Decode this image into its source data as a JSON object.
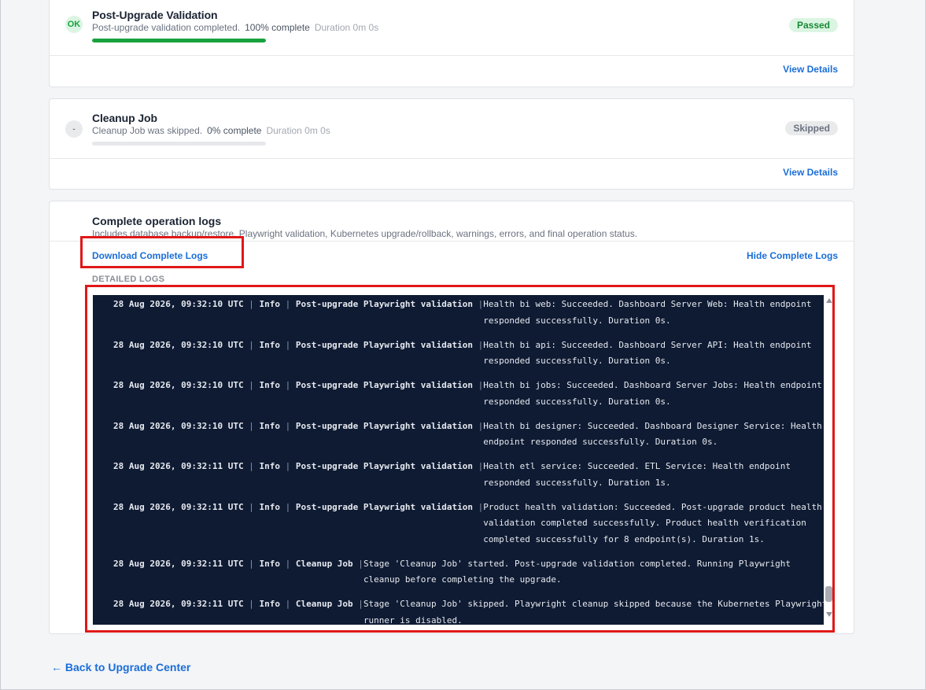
{
  "stages": [
    {
      "icon": "OK",
      "title": "Post-Upgrade Validation",
      "message": "Post-upgrade validation completed.",
      "percent_text": "100% complete",
      "duration": "Duration 0m 0s",
      "progress": 1.0,
      "status": "Passed",
      "view_details": "View Details"
    },
    {
      "icon": "-",
      "title": "Cleanup Job",
      "message": "Cleanup Job was skipped.",
      "percent_text": "0% complete",
      "duration": "Duration 0m 0s",
      "progress": 0.0,
      "status": "Skipped",
      "view_details": "View Details"
    }
  ],
  "logs_panel": {
    "title": "Complete operation logs",
    "description": "Includes database backup/restore, Playwright validation, Kubernetes upgrade/rollback, warnings, errors, and final operation status.",
    "download_label": "Download Complete Logs",
    "hide_label": "Hide Complete Logs",
    "detailed_label": "DETAILED LOGS",
    "entries": [
      {
        "timestamp": "28 Aug 2026, 09:32:10 UTC",
        "level": "Info",
        "stage": "Post-upgrade Playwright validation",
        "lines": [
          "Health bi web: Succeeded. Dashboard Server Web: Health endpoint",
          "responded successfully. Duration 0s."
        ]
      },
      {
        "timestamp": "28 Aug 2026, 09:32:10 UTC",
        "level": "Info",
        "stage": "Post-upgrade Playwright validation",
        "lines": [
          "Health bi api: Succeeded. Dashboard Server API: Health endpoint",
          "responded successfully. Duration 0s."
        ]
      },
      {
        "timestamp": "28 Aug 2026, 09:32:10 UTC",
        "level": "Info",
        "stage": "Post-upgrade Playwright validation",
        "lines": [
          "Health bi jobs: Succeeded. Dashboard Server Jobs: Health endpoint",
          "responded successfully. Duration 0s."
        ]
      },
      {
        "timestamp": "28 Aug 2026, 09:32:10 UTC",
        "level": "Info",
        "stage": "Post-upgrade Playwright validation",
        "lines": [
          "Health bi designer: Succeeded. Dashboard Designer Service: Health",
          "endpoint responded successfully. Duration 0s."
        ]
      },
      {
        "timestamp": "28 Aug 2026, 09:32:11 UTC",
        "level": "Info",
        "stage": "Post-upgrade Playwright validation",
        "lines": [
          "Health etl service: Succeeded. ETL Service: Health endpoint",
          "responded successfully. Duration 1s."
        ]
      },
      {
        "timestamp": "28 Aug 2026, 09:32:11 UTC",
        "level": "Info",
        "stage": "Post-upgrade Playwright validation",
        "lines": [
          "Product health validation: Succeeded. Post-upgrade product health",
          "validation completed successfully. Product health verification",
          "completed successfully for 8 endpoint(s). Duration 1s."
        ]
      },
      {
        "timestamp": "28 Aug 2026, 09:32:11 UTC",
        "level": "Info",
        "stage": "Cleanup Job",
        "lines": [
          "Stage 'Cleanup Job' started. Post-upgrade validation completed. Running Playwright",
          "cleanup before completing the upgrade."
        ]
      },
      {
        "timestamp": "28 Aug 2026, 09:32:11 UTC",
        "level": "Info",
        "stage": "Cleanup Job",
        "lines": [
          "Stage 'Cleanup Job' skipped. Playwright cleanup skipped because the Kubernetes Playwright",
          "runner is disabled."
        ]
      }
    ]
  },
  "back_link": "← Back to Upgrade Center",
  "colors": {
    "accent": "#1a6ed8",
    "success": "#18a23d",
    "terminal_bg": "#0f1b33",
    "highlight": "#e01818"
  }
}
